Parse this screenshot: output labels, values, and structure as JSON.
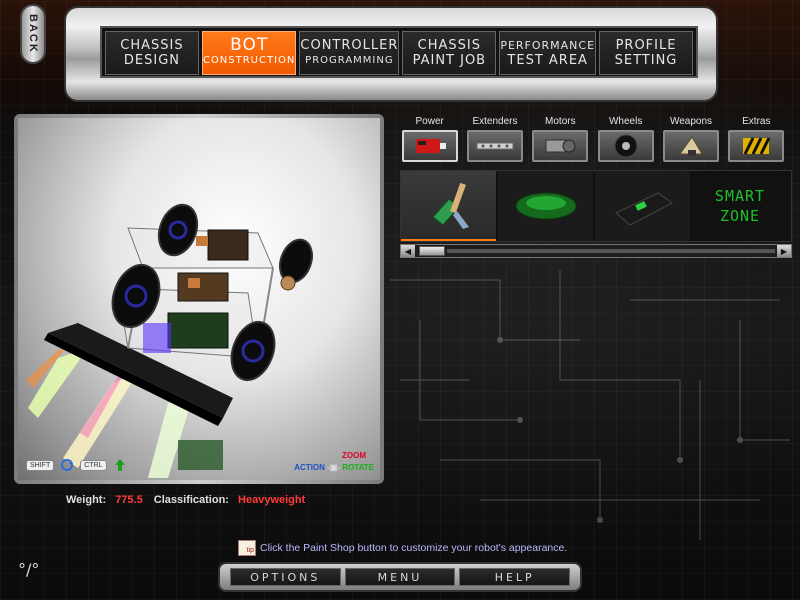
{
  "back_button": {
    "label": "BACK"
  },
  "nav_tabs": [
    {
      "line1": "CHASSIS",
      "line2": "DESIGN",
      "active": false
    },
    {
      "line1": "BOT",
      "line2": "CONSTRUCTION",
      "active": true
    },
    {
      "line1": "CONTROLLER",
      "line2": "PROGRAMMING",
      "active": false
    },
    {
      "line1": "CHASSIS",
      "line2": "PAINT JOB",
      "active": false
    },
    {
      "line1": "PERFORMANCE",
      "line2": "TEST AREA",
      "active": false
    },
    {
      "line1": "PROFILE",
      "line2": "SETTING",
      "active": false
    }
  ],
  "viewport": {
    "keys": {
      "shift": "SHIFT",
      "ctrl": "CTRL"
    },
    "legend": {
      "zoom": "ZOOM",
      "action": "ACTION",
      "rotate": "ROTATE"
    }
  },
  "stats": {
    "weight_label": "Weight:",
    "weight_value": "775.5",
    "class_label": "Classification:",
    "class_value": "Heavyweight"
  },
  "categories": [
    {
      "label": "Power",
      "icon": "battery-icon"
    },
    {
      "label": "Extenders",
      "icon": "extender-bar-icon"
    },
    {
      "label": "Motors",
      "icon": "motor-icon"
    },
    {
      "label": "Wheels",
      "icon": "wheel-icon"
    },
    {
      "label": "Weapons",
      "icon": "weapon-icon"
    },
    {
      "label": "Extras",
      "icon": "hazard-plate-icon"
    }
  ],
  "parts": [
    {
      "icon": "power-switch-part-icon",
      "selected": true
    },
    {
      "icon": "green-battery-part-icon",
      "selected": false
    },
    {
      "icon": "black-battery-part-icon",
      "selected": false
    }
  ],
  "smart_zone": {
    "line1": "SMART",
    "line2": "ZONE"
  },
  "tip": {
    "icon_text": "tip",
    "text": "Click the Paint Shop button to customize your robot's appearance."
  },
  "bottom_buttons": [
    {
      "label": "OPTIONS"
    },
    {
      "label": "MENU"
    },
    {
      "label": "HELP"
    }
  ],
  "colors": {
    "accent_orange": "#f25a00",
    "stat_value_red": "#ff3b3b",
    "smart_zone_green": "#1fbf2a",
    "tip_text": "#b9b6ff"
  }
}
